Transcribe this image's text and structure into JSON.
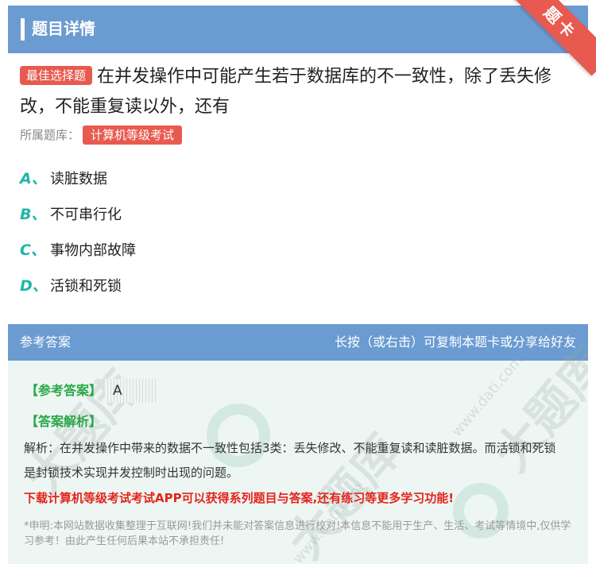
{
  "header": {
    "title": "题目详情"
  },
  "ribbon": {
    "label": "题卡"
  },
  "question": {
    "badge": "最佳选择题",
    "text": "在并发操作中可能产生若于数据库的不一致性，除了丢失修改，不能重复读以外，还有"
  },
  "source": {
    "label": "所属题库：",
    "tag": "计算机等级考试"
  },
  "options": [
    {
      "letter": "A、",
      "text": "读脏数据"
    },
    {
      "letter": "B、",
      "text": "不可串行化"
    },
    {
      "letter": "C、",
      "text": "事物内部故障"
    },
    {
      "letter": "D、",
      "text": "活锁和死锁"
    }
  ],
  "answer_panel": {
    "title": "参考答案",
    "hint": "长按（或右击）可复制本题卡或分享给好友",
    "ref_label": "【参考答案】",
    "ref_value": "A",
    "analysis_label": "【答案解析】",
    "analysis": "解析：在并发操作中带来的数据不一致性包括3类：丢失修改、不能重复读和读脏数据。而活锁和死锁是封锁技术实现并发控制时出现的问题。",
    "promo": "下载计算机等级考试考试APP可以获得系列题目与答案,还有练习等更多学习功能!",
    "disclaimer": "*申明:本网站数据收集整理于互联网!我们并未能对答案信息进行校对!本信息不能用于生产、生活、考试等情境中,仅供学习参考！由此产生任何后果本站不承担责任!"
  },
  "colors": {
    "header": "#6a9bd1",
    "accent_red": "#e85a4f",
    "option_letter": "#1fb6a8",
    "answer_green": "#2aa84a",
    "promo_red": "#e3241b"
  }
}
